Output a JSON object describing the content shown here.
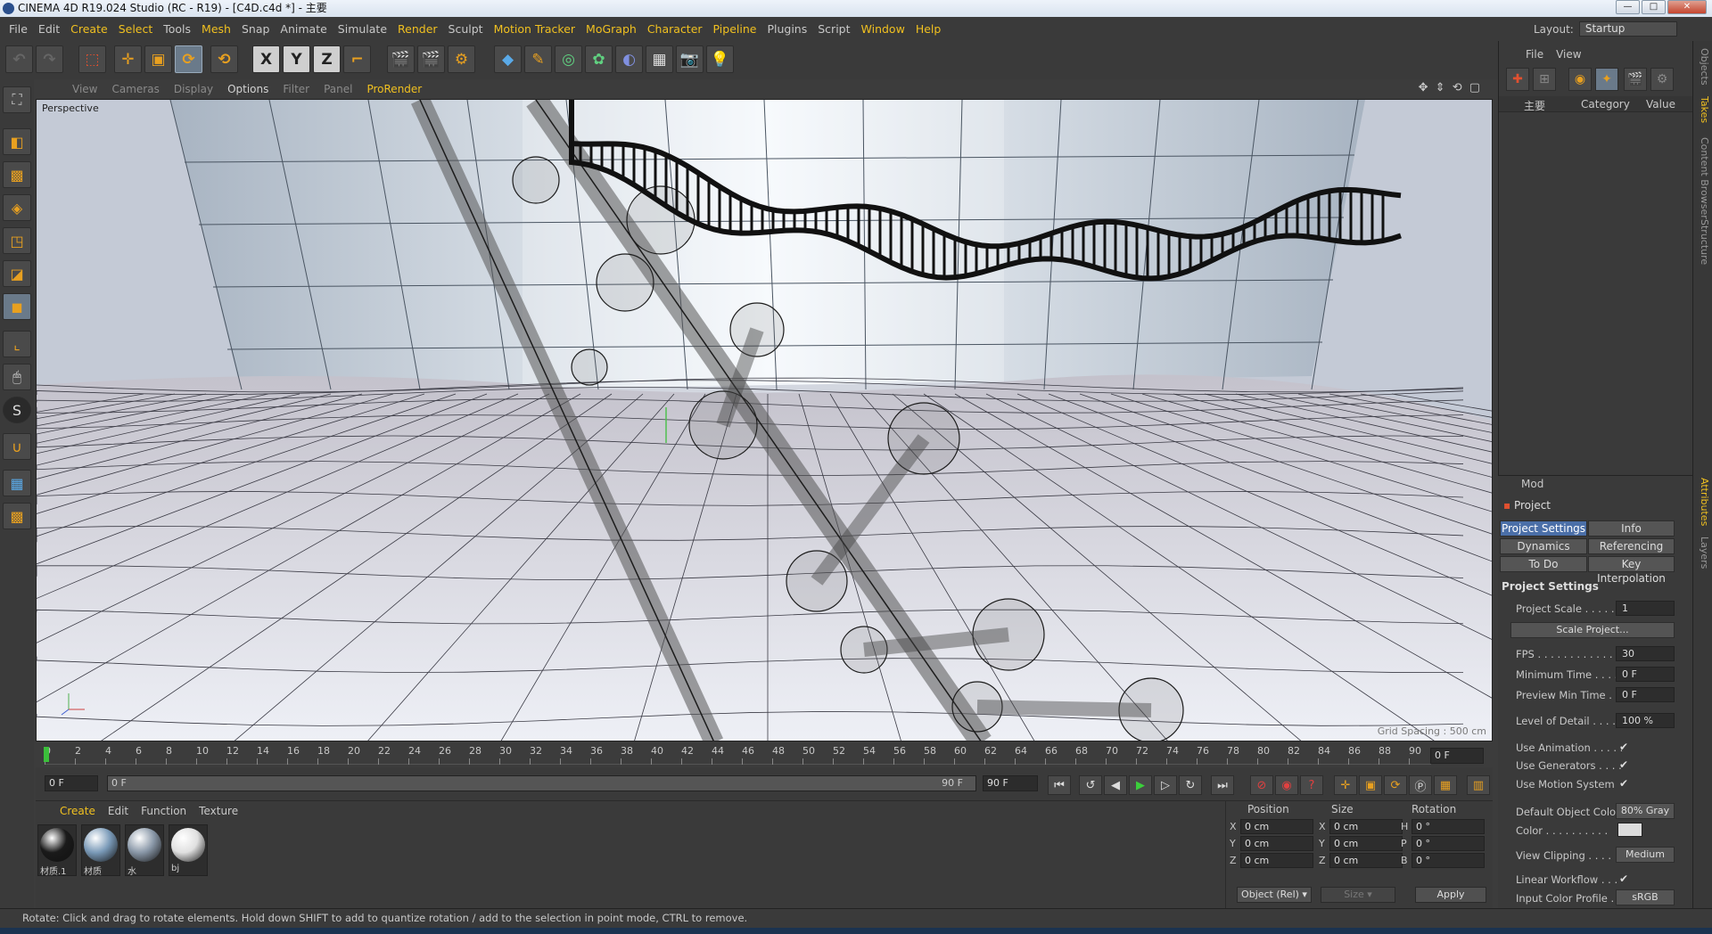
{
  "window": {
    "title": "CINEMA 4D R19.024 Studio (RC - R19) - [C4D.c4d *] - 主要",
    "minimize": "—",
    "maximize": "□",
    "close": "✕"
  },
  "menubar": {
    "items": [
      "File",
      "Edit",
      "Create",
      "Select",
      "Tools",
      "Mesh",
      "Snap",
      "Animate",
      "Simulate",
      "Render",
      "Sculpt",
      "Motion Tracker",
      "MoGraph",
      "Character",
      "Pipeline",
      "Plugins",
      "Script",
      "Window",
      "Help"
    ],
    "highlighted": [
      "Create",
      "Select",
      "Mesh",
      "Render",
      "Motion Tracker",
      "MoGraph",
      "Character",
      "Pipeline",
      "Window",
      "Help"
    ]
  },
  "layout": {
    "label": "Layout:",
    "value": "Startup"
  },
  "toolbar": {
    "x_label": "X",
    "y_label": "Y",
    "z_label": "Z"
  },
  "viewport": {
    "menu": [
      "View",
      "Cameras",
      "Display",
      "Options",
      "Filter",
      "Panel",
      "ProRender"
    ],
    "active": [
      "Options"
    ],
    "prorender": "ProRender",
    "label": "Perspective",
    "grid_spacing": "Grid Spacing : 500 cm",
    "icons": "✥ ⇕ ⟲ ▢"
  },
  "timeline": {
    "ticks": [
      "0",
      "2",
      "4",
      "6",
      "8",
      "10",
      "12",
      "14",
      "16",
      "18",
      "20",
      "22",
      "24",
      "26",
      "28",
      "30",
      "32",
      "34",
      "36",
      "38",
      "40",
      "42",
      "44",
      "46",
      "48",
      "50",
      "52",
      "54",
      "56",
      "58",
      "60",
      "62",
      "64",
      "66",
      "68",
      "70",
      "72",
      "74",
      "76",
      "78",
      "80",
      "82",
      "84",
      "86",
      "88",
      "90"
    ],
    "current_frame": "0 F"
  },
  "transport": {
    "start": "0 F",
    "slider_start": "0 F",
    "slider_end": "90 F",
    "end": "90 F"
  },
  "materials": {
    "menu": [
      "Create",
      "Edit",
      "Function",
      "Texture"
    ],
    "active": "Create",
    "items": [
      {
        "name": "材质.1",
        "color": "#1a1a1a"
      },
      {
        "name": "材质",
        "color": "#7a9ab8"
      },
      {
        "name": "水",
        "color": "#8a98a8"
      },
      {
        "name": "bj",
        "color": "#e0e0e0"
      }
    ]
  },
  "coords": {
    "headers": [
      "Position",
      "Size",
      "Rotation"
    ],
    "rows": [
      {
        "axis": "X",
        "pos": "0 cm",
        "saxis": "X",
        "size": "0 cm",
        "raxis": "H",
        "rot": "0 °"
      },
      {
        "axis": "Y",
        "pos": "0 cm",
        "saxis": "Y",
        "size": "0 cm",
        "raxis": "P",
        "rot": "0 °"
      },
      {
        "axis": "Z",
        "pos": "0 cm",
        "saxis": "Z",
        "size": "0 cm",
        "raxis": "B",
        "rot": "0 °"
      }
    ],
    "mode": "Object (Rel) ▾",
    "size_mode": "Size ▾",
    "apply": "Apply"
  },
  "objects": {
    "menu": [
      "File",
      "View"
    ],
    "take_col": "主要",
    "category": "Category",
    "value": "Value"
  },
  "right_tabs": [
    "Objects",
    "Takes",
    "Content Browser",
    "Structure",
    "Attributes",
    "Layers"
  ],
  "attributes": {
    "mode": "Mod",
    "title": "Project",
    "tabs": [
      "Project Settings",
      "Info",
      "Dynamics",
      "Referencing",
      "To Do",
      "Key Interpolation"
    ],
    "section": "Project Settings",
    "project_scale": {
      "label": "Project Scale . . . . . .",
      "value": "1"
    },
    "scale_button": "Scale Project...",
    "fps": {
      "label": "FPS . . . . . . . . . . . . . .",
      "value": "30"
    },
    "min_time": {
      "label": "Minimum Time . . . .",
      "value": "0 F"
    },
    "preview_min": {
      "label": "Preview Min Time . .",
      "value": "0 F"
    },
    "lod": {
      "label": "Level of Detail . . . . .",
      "value": "100 %"
    },
    "use_animation": {
      "label": "Use Animation . . . . .",
      "value": "✔"
    },
    "use_generators": {
      "label": "Use Generators . . . .",
      "value": "✔"
    },
    "use_motion": {
      "label": "Use Motion System",
      "value": "✔"
    },
    "default_color": {
      "label": "Default Object Color",
      "value": "80% Gray"
    },
    "color": {
      "label": "Color . . . . . . . . . .",
      "swatch": "#dcdcdc"
    },
    "view_clipping": {
      "label": "View Clipping . . . .",
      "value": "Medium"
    },
    "linear_workflow": {
      "label": "Linear Workflow . . .",
      "value": "✔"
    },
    "input_color": {
      "label": "Input Color Profile . .",
      "value": "sRGB"
    }
  },
  "status": "Rotate: Click and drag to rotate elements. Hold down SHIFT to add to quantize rotation / add to the selection in point mode, CTRL to remove."
}
